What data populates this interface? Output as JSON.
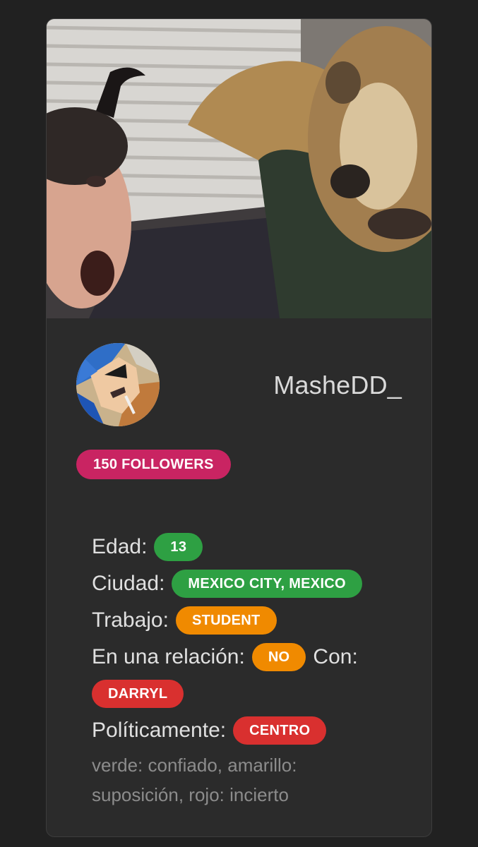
{
  "profile": {
    "username": "MasheDD_",
    "followers_label": "150 FOLLOWERS",
    "banner_alt": "profile-banner-image",
    "avatar_alt": "profile-avatar-image"
  },
  "details": {
    "age_label": "Edad:",
    "age_value": "13",
    "city_label": "Ciudad:",
    "city_value": "MEXICO CITY, MEXICO",
    "job_label": "Trabajo:",
    "job_value": "STUDENT",
    "relationship_label": "En una relación:",
    "relationship_value": "NO",
    "with_label": "Con:",
    "with_value": "DARRYL",
    "politics_label": "Políticamente:",
    "politics_value": "CENTRO",
    "legend_note": "verde: confiado, amarillo: suposición, rojo: incierto"
  },
  "colors": {
    "background": "#212121",
    "card": "#2b2b2b",
    "followers_badge": "#c92462",
    "green": "#2ea043",
    "orange": "#f08a00",
    "red": "#d9302f"
  }
}
